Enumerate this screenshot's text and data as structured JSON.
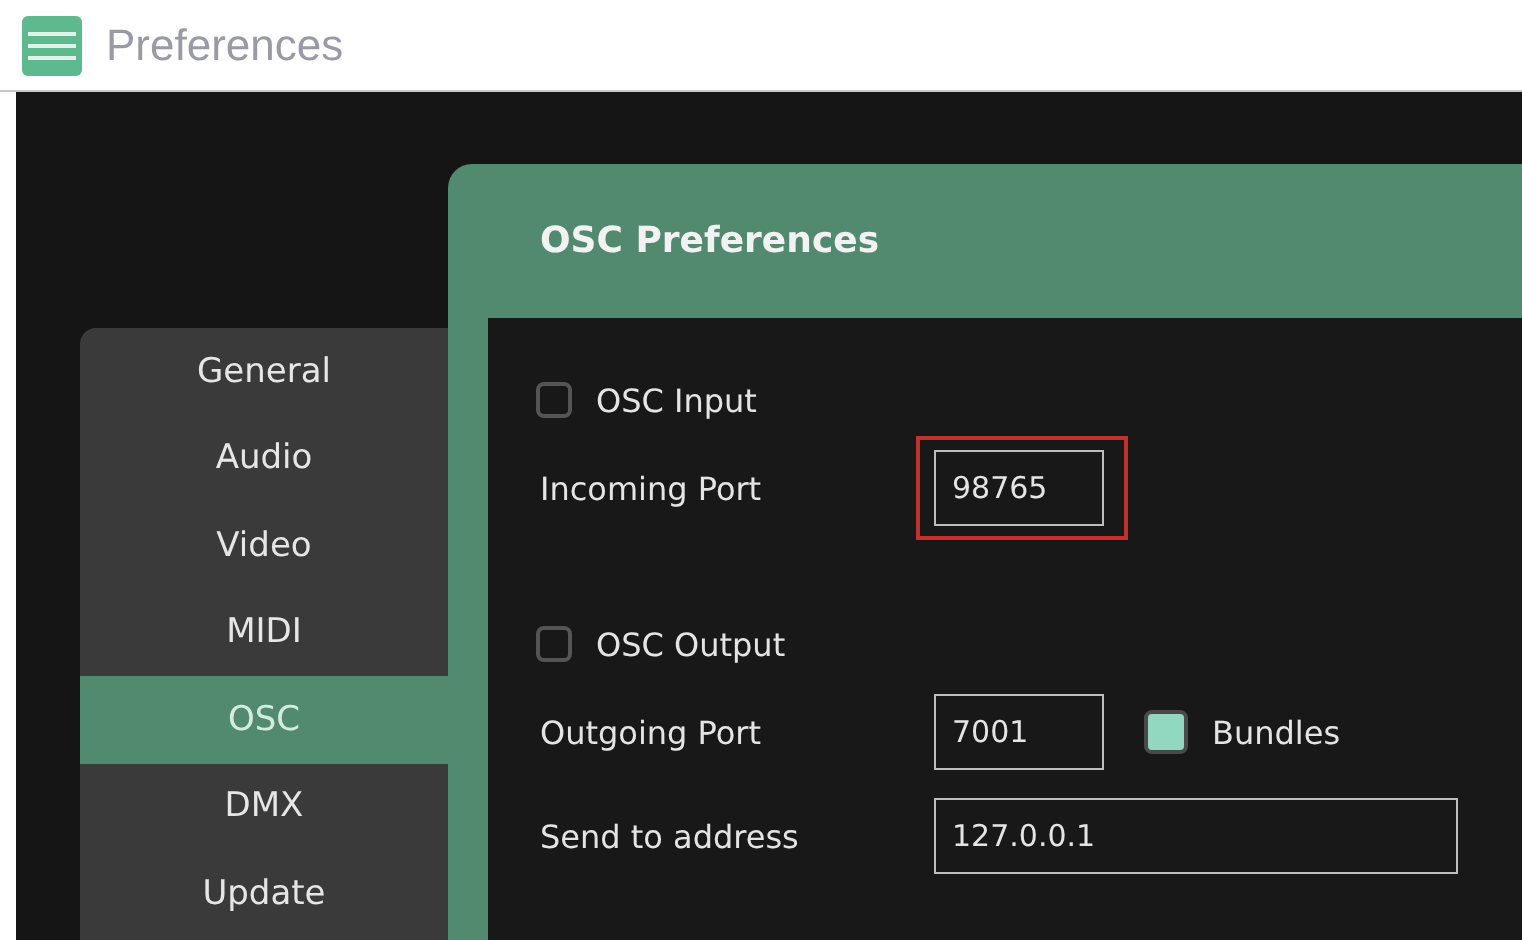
{
  "window": {
    "title": "Preferences"
  },
  "sidebar": {
    "items": [
      {
        "label": "General",
        "selected": false
      },
      {
        "label": "Audio",
        "selected": false
      },
      {
        "label": "Video",
        "selected": false
      },
      {
        "label": "MIDI",
        "selected": false
      },
      {
        "label": "OSC",
        "selected": true
      },
      {
        "label": "DMX",
        "selected": false
      },
      {
        "label": "Update",
        "selected": false
      }
    ]
  },
  "panel": {
    "title": "OSC Preferences",
    "rows": [
      {
        "kind": "checkbox",
        "label": "OSC Input",
        "checked": false
      },
      {
        "kind": "field",
        "label": "Incoming Port",
        "value": "98765",
        "highlighted": true
      },
      {
        "kind": "spacer"
      },
      {
        "kind": "checkbox",
        "label": "OSC Output",
        "checked": false
      },
      {
        "kind": "field",
        "label": "Outgoing Port",
        "value": "7001",
        "highlighted": false,
        "option": {
          "label": "Bundles",
          "checked": true
        }
      },
      {
        "kind": "wide-field",
        "label": "Send to address",
        "value": "127.0.0.1",
        "highlighted": false
      }
    ]
  }
}
